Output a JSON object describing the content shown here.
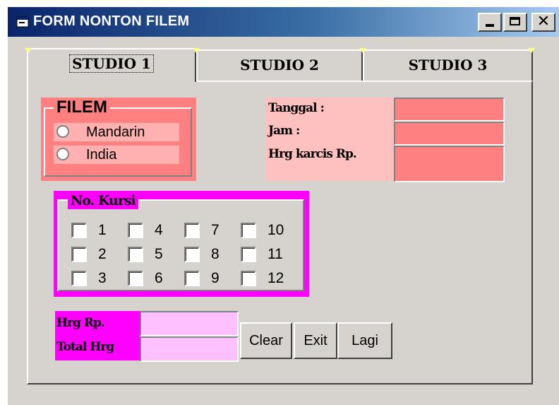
{
  "window": {
    "title": "FORM NONTON FILEM"
  },
  "tabs": [
    {
      "label": "STUDIO 1",
      "active": true
    },
    {
      "label": "STUDIO 2",
      "active": false
    },
    {
      "label": "STUDIO 3",
      "active": false
    }
  ],
  "filem": {
    "title": "FILEM",
    "options": [
      "Mandarin",
      "India"
    ]
  },
  "info": {
    "tanggal_label": "Tanggal :",
    "jam_label": "Jam :",
    "harga_karcis_label": "Hrg karcis Rp.",
    "tanggal_value": "",
    "jam_value": "",
    "harga_karcis_value": ""
  },
  "kursi": {
    "title": "No. Kursi",
    "seats": [
      "1",
      "2",
      "3",
      "4",
      "5",
      "6",
      "7",
      "8",
      "9",
      "10",
      "11",
      "12"
    ]
  },
  "harga": {
    "hrg_label": "Hrg Rp.",
    "total_label": "Total Hrg",
    "hrg_value": "",
    "total_value": ""
  },
  "buttons": {
    "clear": "Clear",
    "exit": "Exit",
    "lagi": "Lagi"
  },
  "colors": {
    "filem_bg": "#ff8080",
    "info_bg": "#ffc0c0",
    "kursi_bg": "#ff00ff",
    "harga_field_bg": "#ffc0ff"
  }
}
